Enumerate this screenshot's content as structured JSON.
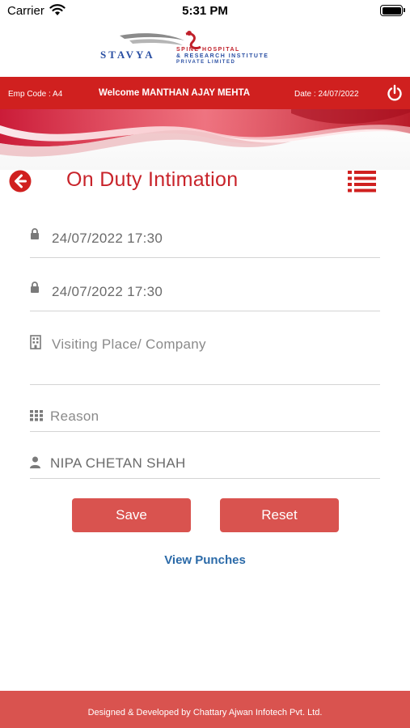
{
  "status_bar": {
    "carrier": "Carrier",
    "time": "5:31 PM"
  },
  "logo": {
    "name": "STAVYA",
    "line1": "SPINE HOSPITAL",
    "line2": "& RESEARCH INSTITUTE",
    "line3": "PRIVATE LIMITED"
  },
  "header": {
    "emp_code": "Emp Code : A4",
    "welcome": "Welcome MANTHAN AJAY MEHTA",
    "date": "Date : 24/07/2022"
  },
  "page": {
    "title": "On Duty Intimation"
  },
  "form": {
    "from_datetime": "24/07/2022 17:30",
    "to_datetime": "24/07/2022 17:30",
    "visiting_place_placeholder": "Visiting Place/ Company",
    "reason_placeholder": "Reason",
    "person": "NIPA CHETAN SHAH"
  },
  "actions": {
    "save": "Save",
    "reset": "Reset",
    "view_punches": "View Punches"
  },
  "footer": {
    "credit": "Designed & Developed by Chattary Ajwan Infotech Pvt. Ltd."
  },
  "colors": {
    "primary_red": "#d0201f",
    "button_red": "#d9534f",
    "title_red": "#c8232a",
    "link_blue": "#2b6aa8"
  },
  "icons": {
    "back": "back-arrow-circle-icon",
    "menu": "list-icon",
    "power": "power-icon",
    "lock": "lock-icon",
    "building": "building-icon",
    "grid": "grid-icon",
    "user": "user-icon"
  }
}
